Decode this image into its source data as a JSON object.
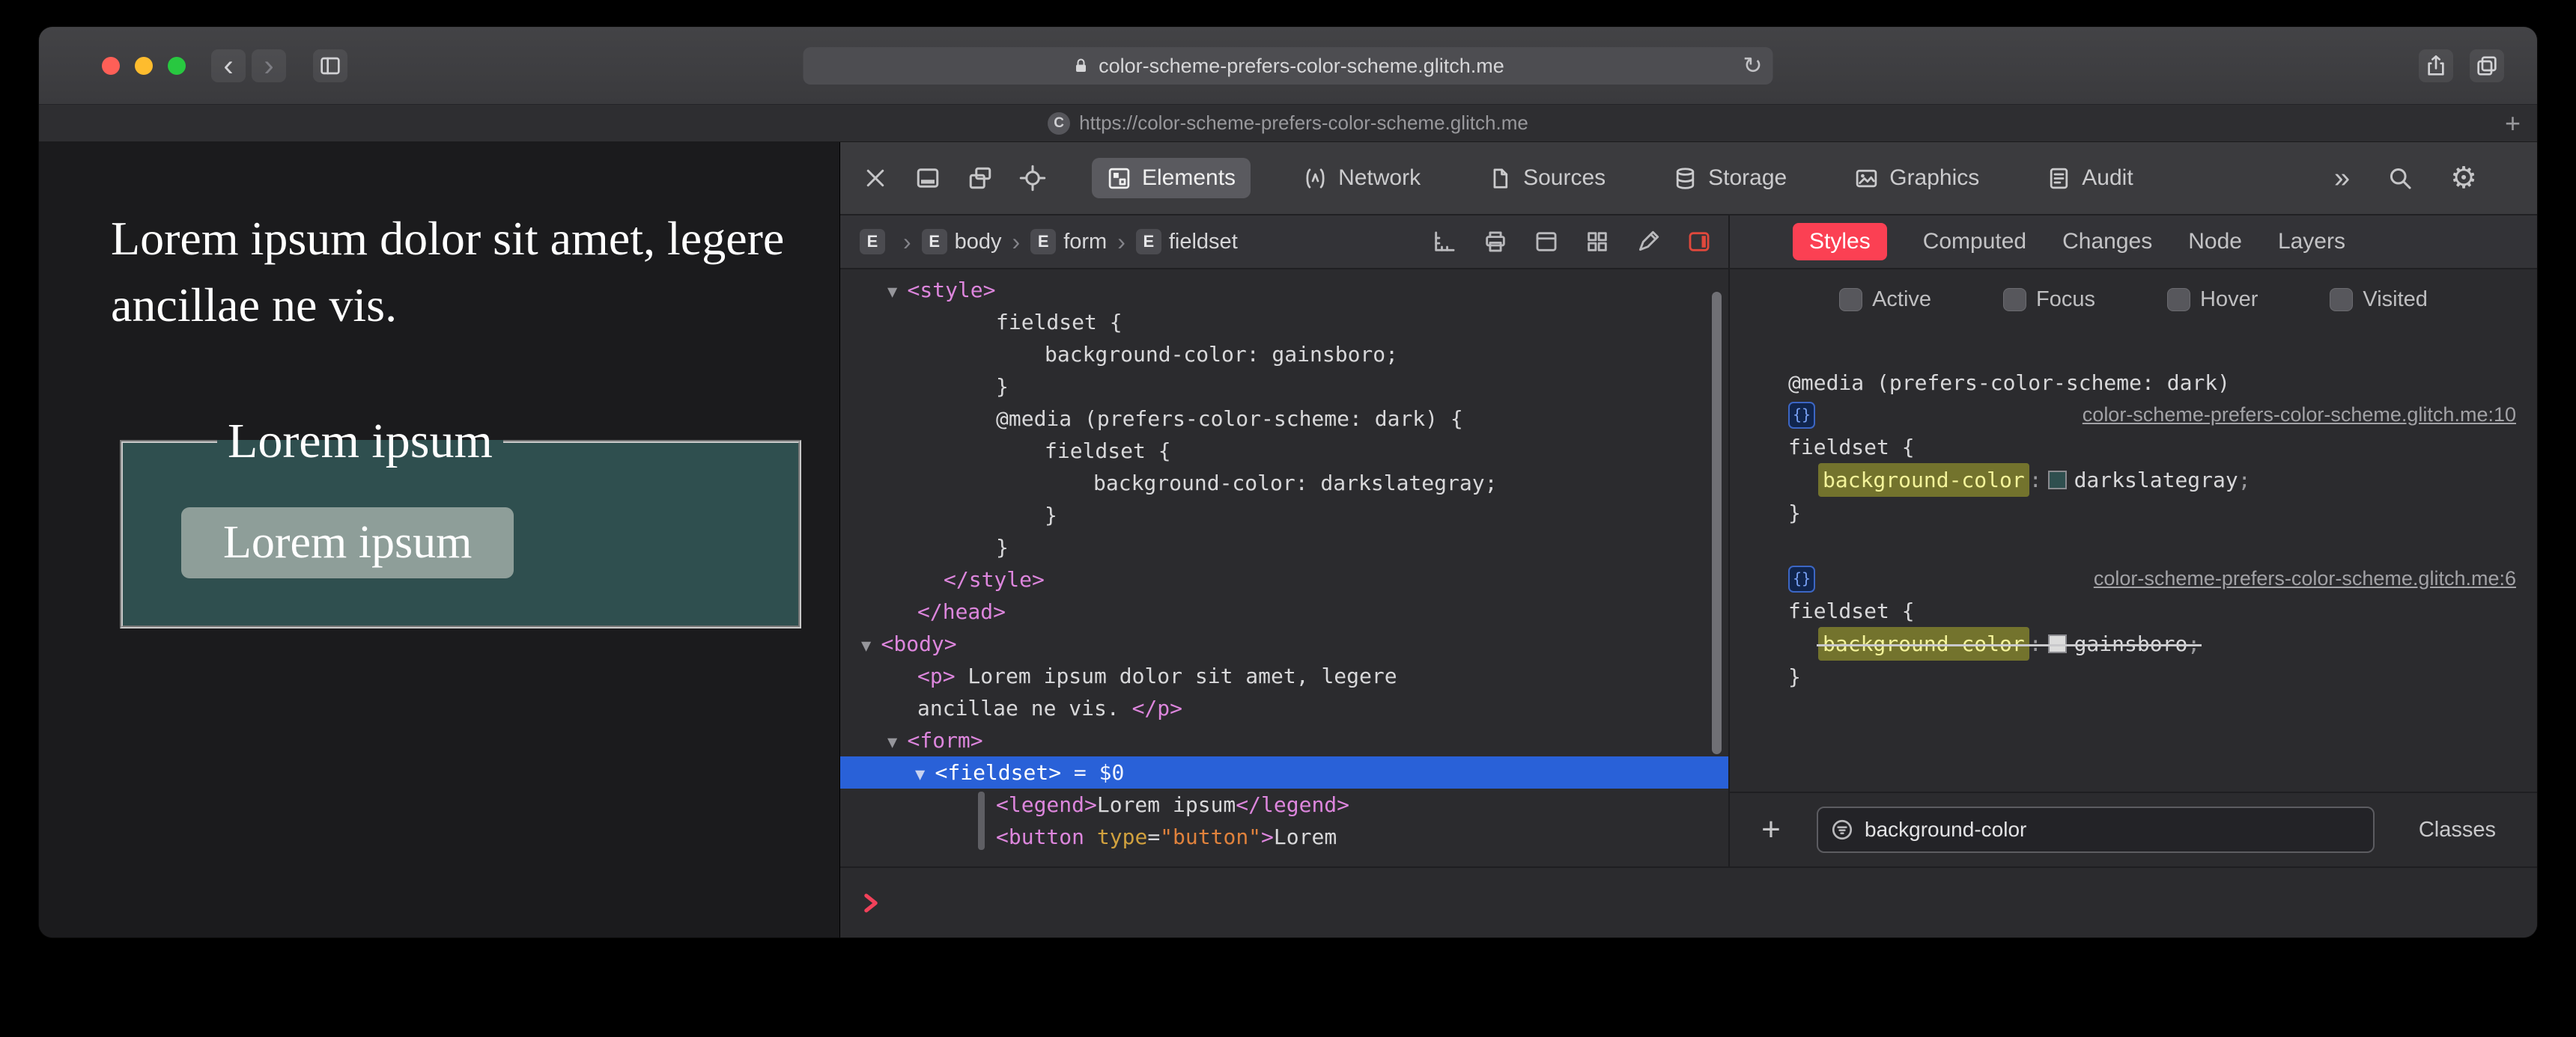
{
  "colors": {
    "selection_blue": "#2961d8",
    "styles_tab_red": "#fb4053",
    "fieldset_bg": "#2f4f4f",
    "darkslategray_swatch": "#2f4f4f",
    "gainsboro_swatch": "#dcdcdc",
    "filter_highlight_bg": "#73732d",
    "console_prompt_red": "#f2415a"
  },
  "icons": {
    "reload": "↻",
    "settings": "⚙",
    "more_tabs": "»",
    "breadcrumb_separator": "›",
    "back": "‹",
    "forward": "›",
    "add_tab": "+",
    "add_rule": "+",
    "curly_badge": "{}"
  },
  "chrome": {
    "url": "color-scheme-prefers-color-scheme.glitch.me",
    "tab_title": "https://color-scheme-prefers-color-scheme.glitch.me",
    "favicon_letter": "C"
  },
  "page": {
    "paragraph": "Lorem ipsum dolor sit amet, legere ancillae ne vis.",
    "legend": "Lorem ipsum",
    "button_label": "Lorem ipsum"
  },
  "inspector": {
    "main_tabs": [
      {
        "label": "Elements"
      },
      {
        "label": "Network"
      },
      {
        "label": "Sources"
      },
      {
        "label": "Storage"
      },
      {
        "label": "Graphics"
      },
      {
        "label": "Audit"
      }
    ],
    "breadcrumbs": [
      {
        "badge": "E",
        "label": ""
      },
      {
        "badge": "E",
        "label": "body"
      },
      {
        "badge": "E",
        "label": "form"
      },
      {
        "badge": "E",
        "label": "fieldset"
      }
    ],
    "sidebar_tabs": [
      {
        "label": "Styles"
      },
      {
        "label": "Computed"
      },
      {
        "label": "Changes"
      },
      {
        "label": "Node"
      },
      {
        "label": "Layers"
      }
    ],
    "pseudo_toggles": [
      {
        "label": "Active"
      },
      {
        "label": "Focus"
      },
      {
        "label": "Hover"
      },
      {
        "label": "Visited"
      }
    ],
    "dom_tree": [
      {
        "pad": 63,
        "segs": [
          {
            "t": "▼ ",
            "c": "tri"
          },
          {
            "t": "<style>",
            "c": "tag"
          }
        ]
      },
      {
        "pad": 208,
        "segs": [
          {
            "t": "fieldset {",
            "c": "txt"
          }
        ]
      },
      {
        "pad": 273,
        "segs": [
          {
            "t": "background-color: gainsboro;",
            "c": "txt"
          }
        ]
      },
      {
        "pad": 208,
        "segs": [
          {
            "t": "}",
            "c": "txt"
          }
        ]
      },
      {
        "pad": 208,
        "segs": [
          {
            "t": "@media (prefers-color-scheme: dark) {",
            "c": "txt"
          }
        ]
      },
      {
        "pad": 273,
        "segs": [
          {
            "t": "fieldset {",
            "c": "txt"
          }
        ]
      },
      {
        "pad": 338,
        "segs": [
          {
            "t": "background-color: darkslategray;",
            "c": "txt"
          }
        ]
      },
      {
        "pad": 273,
        "segs": [
          {
            "t": "}",
            "c": "txt"
          }
        ]
      },
      {
        "pad": 208,
        "segs": [
          {
            "t": "}",
            "c": "txt"
          }
        ]
      },
      {
        "pad": 138,
        "segs": [
          {
            "t": "</style>",
            "c": "tag"
          }
        ]
      },
      {
        "pad": 103,
        "segs": [
          {
            "t": "</head>",
            "c": "tag"
          }
        ]
      },
      {
        "pad": 28,
        "segs": [
          {
            "t": "▼ ",
            "c": "tri"
          },
          {
            "t": "<body>",
            "c": "tag"
          }
        ]
      },
      {
        "pad": 103,
        "segs": [
          {
            "t": "<p>",
            "c": "tag"
          },
          {
            "t": " Lorem ipsum dolor sit amet, legere",
            "c": "txt"
          }
        ]
      },
      {
        "pad": 103,
        "segs": [
          {
            "t": "ancillae ne vis. ",
            "c": "txt"
          },
          {
            "t": "</p>",
            "c": "tag"
          }
        ]
      },
      {
        "pad": 63,
        "segs": [
          {
            "t": "▼ ",
            "c": "tri"
          },
          {
            "t": "<form>",
            "c": "tag"
          }
        ]
      },
      {
        "pad": 100,
        "selected": true,
        "segs": [
          {
            "t": "▼ ",
            "c": "tri"
          },
          {
            "t": "<fieldset>",
            "c": "tag"
          },
          {
            "t": " = $0",
            "c": "note"
          }
        ]
      },
      {
        "pad": 208,
        "segs": [
          {
            "t": "<legend>",
            "c": "tag"
          },
          {
            "t": "Lorem ipsum",
            "c": "txt"
          },
          {
            "t": "</legend>",
            "c": "tag"
          }
        ]
      },
      {
        "pad": 208,
        "segs": [
          {
            "t": "<button",
            "c": "tag"
          },
          {
            "t": " type",
            "c": "attr"
          },
          {
            "t": "=",
            "c": "txt"
          },
          {
            "t": "\"button\"",
            "c": "val"
          },
          {
            "t": ">",
            "c": "tag"
          },
          {
            "t": "Lorem",
            "c": "txt"
          }
        ]
      }
    ],
    "styles_panel": {
      "media_query": "@media (prefers-color-scheme: dark)",
      "rules": [
        {
          "link": "color-scheme-prefers-color-scheme.glitch.me:10",
          "selector": "fieldset {",
          "property": "background-color",
          "colon": ":",
          "swatch": "#2f4f4f",
          "value": "darkslategray",
          "semicolon": ";",
          "close": "}"
        },
        {
          "link": "color-scheme-prefers-color-scheme.glitch.me:6",
          "selector": "fieldset {",
          "property": "background-color",
          "colon": ":",
          "swatch": "#dcdcdc",
          "value": "gainsboro",
          "semicolon": ";",
          "close": "}"
        }
      ],
      "filter_value": "background-color",
      "classes_label": "Classes"
    }
  }
}
